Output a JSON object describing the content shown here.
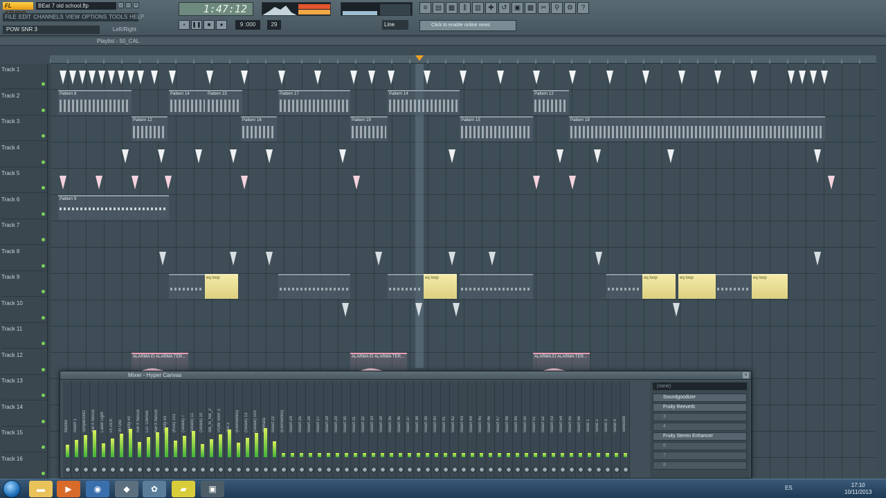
{
  "app": {
    "logo": "FL STUDIO",
    "file_title": "BEat 7 old school.flp",
    "menus": [
      "FILE",
      "EDIT",
      "CHANNELS",
      "VIEW",
      "OPTIONS",
      "TOOLS",
      "HELP"
    ],
    "hint_left": "POW SNR 3",
    "hint_right": "Left/Right"
  },
  "transport": {
    "time": "1:47:12",
    "tempo": "9 :000",
    "pattern": "29",
    "snap": "Line",
    "hint": "Click to enable online news"
  },
  "playlist": {
    "title": "Playlist - 50_CAL",
    "tracks": [
      "Track 1",
      "Track 2",
      "Track 3",
      "Track 4",
      "Track 5",
      "Track 6",
      "Track 7",
      "Track 8",
      "Track 9",
      "Track 10",
      "Track 11",
      "Track 12",
      "Track 13",
      "Track 14",
      "Track 15",
      "Track 16"
    ],
    "clip_labels": {
      "p8": "Pattern 8",
      "p14": "Pattern 14",
      "p15": "Pattern 15",
      "p17": "Pattern 17",
      "p12": "Pattern 12",
      "p16": "Pattern 16",
      "p19": "Pattern 19",
      "p22": "Pattern 22",
      "p23": "Pattern 23",
      "p24": "Pattern 24",
      "p9": "Pattern 9",
      "p10": "Pattern 10",
      "p11": "Pattern 11",
      "alarma": "ALARMA EI ALARMA TER...",
      "loop": "eq loop"
    }
  },
  "mixer": {
    "title": "Mixer - Hyper Canvas",
    "input": "(none)",
    "channels": [
      "Master",
      "Insert 1",
      "SimpleSlnt2",
      "riaFX Nexus",
      "Laser Light",
      "PLUCK",
      "3x Osc",
      "Purity #2",
      "riaFX Nexus",
      "LD- Chimes",
      "riaFX Nexus",
      "Purity #3",
      "(Kick) 101",
      "(Snare) 7",
      "(Snare) 11",
      "(Snare) 10",
      "old_hi_hat_2",
      "POW SNR 3",
      "vox 2",
      "(Elementos)",
      "(Snare) 13",
      "(Snare) 103",
      "clemata",
      "Insert 22",
      "(Elementos)",
      "Insert 24",
      "Insert 25",
      "Insert 26",
      "Insert 27",
      "Insert 28",
      "Insert 29",
      "Insert 30",
      "Insert 31",
      "Insert 32",
      "Insert 33",
      "Insert 34",
      "Insert 35",
      "Insert 36",
      "Insert 37",
      "Insert 38",
      "Insert 39",
      "Insert 40",
      "Insert 41",
      "Insert 42",
      "Insert 43",
      "Insert 44",
      "Insert 45",
      "Insert 46",
      "Insert 47",
      "Insert 48",
      "Insert 49",
      "Insert 50",
      "Insert 51",
      "Insert 52",
      "Insert 53",
      "Insert 54",
      "Insert 55",
      "Insert 56",
      "Send 1",
      "Send 2",
      "Send 3",
      "Send 4",
      "Selected"
    ],
    "fx": [
      "Soundgoodizer",
      "Fruity Reeverb",
      "3",
      "4",
      "Fruity Stereo Enhancer",
      "6",
      "7",
      "8"
    ]
  },
  "taskbar": {
    "lang": "ES",
    "time": "17:10",
    "date": "10/11/2013"
  }
}
